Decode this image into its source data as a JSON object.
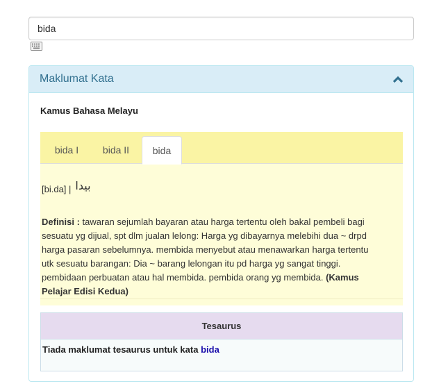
{
  "search": {
    "value": "bida"
  },
  "icons": {
    "keyboard": "keyboard-icon",
    "collapse": "chevron-up-icon"
  },
  "panel": {
    "title": "Maklumat Kata",
    "dictionary_title": "Kamus Bahasa Melayu"
  },
  "tabs": [
    {
      "label": "bida I",
      "active": false
    },
    {
      "label": "bida II",
      "active": false
    },
    {
      "label": "bida",
      "active": true
    }
  ],
  "entry": {
    "pronunciation": "[bi.da] |",
    "jawi": "بيدا",
    "definition_label": "Definisi :",
    "definition_lines": [
      "tawaran sejumlah bayaran atau harga tertentu oleh bakal pembeli bagi",
      "sesuatu yg dijual, spt dlm jualan lelong: Harga yg dibayarnya melebihi dua ~ drpd",
      "harga pasaran sebelumnya. membida menyebut atau menawarkan harga tertentu",
      "utk sesuatu barangan: Dia ~ barang lelongan itu pd harga yg sangat tinggi.",
      "pembidaan perbuatan atau hal membida. pembida orang yg membida."
    ],
    "source_line1": "(Kamus",
    "source_line2": "Pelajar Edisi Kedua)"
  },
  "thesaurus": {
    "heading": "Tesaurus",
    "message": "Tiada maklumat tesaurus untuk kata",
    "word": "bida"
  },
  "colors": {
    "panel_heading_bg": "#d9edf7",
    "panel_title": "#31708f",
    "tab_bar_bg": "#faf4a4",
    "content_bg": "#fefdd8",
    "thesaurus_heading_bg": "#e6dbef",
    "link": "#1a0dab"
  }
}
